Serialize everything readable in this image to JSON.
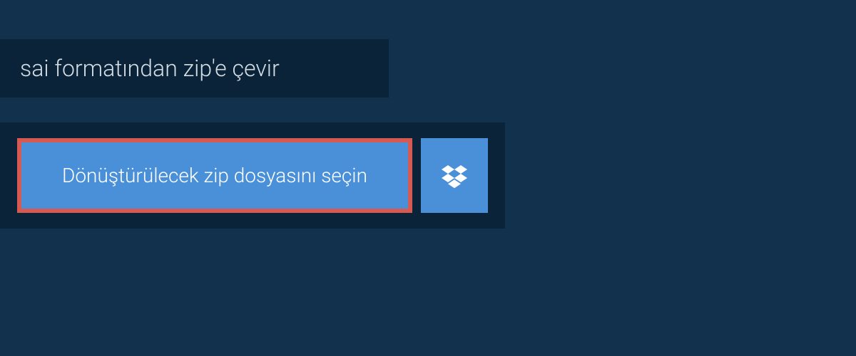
{
  "header": {
    "title": "sai formatından zip'e çevir"
  },
  "actions": {
    "select_file_label": "Dönüştürülecek zip dosyasını seçin"
  },
  "colors": {
    "background": "#11314d",
    "panel": "#0a2338",
    "button": "#4a90d9",
    "button_highlight_border": "#d65a52",
    "text_light": "#d4dde4",
    "text_white": "#ffffff"
  }
}
